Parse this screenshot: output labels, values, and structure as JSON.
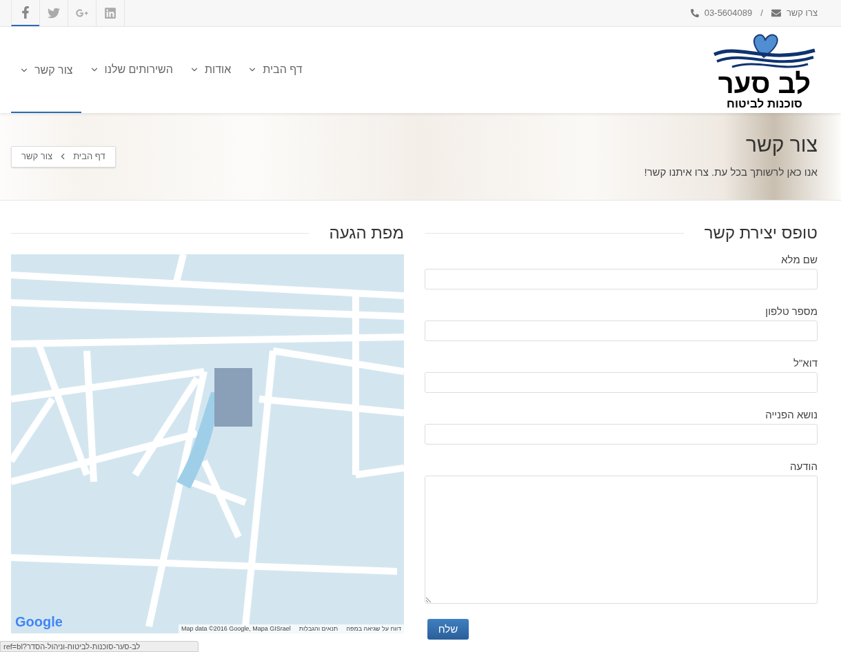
{
  "topbar": {
    "contact_label": "צרו קשר",
    "separator": "/",
    "phone": "03-5604089",
    "social": [
      {
        "kind": "facebook",
        "selected": true
      },
      {
        "kind": "twitter",
        "selected": false
      },
      {
        "kind": "googleplus",
        "selected": false
      },
      {
        "kind": "linkedin",
        "selected": false
      }
    ]
  },
  "logo": {
    "name": "לב סער",
    "tagline": "סוכנות לביטוח"
  },
  "nav": [
    {
      "label": "דף הבית",
      "selected": false
    },
    {
      "label": "אודות",
      "selected": false
    },
    {
      "label": "השירותים שלנו",
      "selected": false
    },
    {
      "label": "צור קשר",
      "selected": true
    }
  ],
  "banner": {
    "title": "צור קשר",
    "subtitle": "אנו כאן לרשותך בכל עת. צרו איתנו קשר!",
    "breadcrumb": [
      "דף הבית",
      "צור קשר"
    ]
  },
  "form": {
    "title": "טופס יצירת קשר",
    "fields": [
      {
        "label": "שם מלא",
        "kind": "input"
      },
      {
        "label": "מספר טלפון",
        "kind": "input"
      },
      {
        "label": "דוא\"ל",
        "kind": "input"
      },
      {
        "label": "נושא הפנייה",
        "kind": "input"
      },
      {
        "label": "הודעה",
        "kind": "textarea"
      }
    ],
    "submit": "שלח"
  },
  "map": {
    "title": "מפת הגעה",
    "logo": "Google",
    "attribution": "Map data ©2016 Google, Mapa GISrael",
    "links": [
      "דווח על שגיאה במפה",
      "תנאים והגבלות"
    ]
  },
  "status_url": "לב-סער-סוכנות-לביטוח-וניהול-הסדר?ref=bl"
}
